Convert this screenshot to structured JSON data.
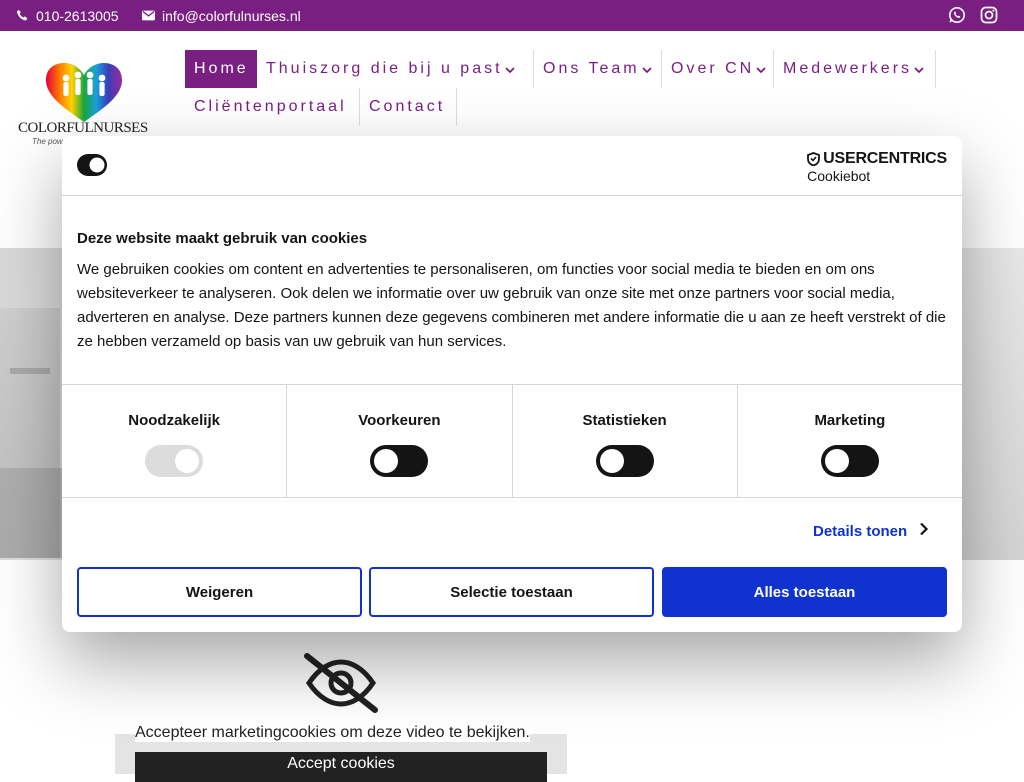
{
  "topbar": {
    "phone": "010-2613005",
    "email": "info@colorfulnurses.nl",
    "phone_icon": "phone-icon",
    "email_icon": "envelope-icon",
    "social_icons": [
      "whatsapp-icon",
      "instagram-icon"
    ],
    "background": "#7a1f82"
  },
  "logo": {
    "text": "COLORFULNURSES",
    "tagline": "The pow"
  },
  "nav": {
    "items": [
      {
        "label": "Home",
        "active": true,
        "dropdown": false
      },
      {
        "label": "Thuiszorg die bij u past",
        "active": false,
        "dropdown": true
      },
      {
        "label": "Ons Team",
        "active": false,
        "dropdown": true
      },
      {
        "label": "Over CN",
        "active": false,
        "dropdown": true
      },
      {
        "label": "Medewerkers",
        "active": false,
        "dropdown": true
      },
      {
        "label": "Cliëntenportaal",
        "active": false,
        "dropdown": false
      },
      {
        "label": "Contact",
        "active": false,
        "dropdown": false
      }
    ],
    "accent": "#7a1f82"
  },
  "video": {
    "message": "Accepteer marketingcookies om deze video te bekijken.",
    "button": "Accept cookies",
    "icon": "eye-slash-icon"
  },
  "cookie_dialog": {
    "brand_line1": "USERCENTRICS",
    "brand_line2": "Cookiebot",
    "title": "Deze website maakt gebruik van cookies",
    "body": "We gebruiken cookies om content en advertenties te personaliseren, om functies voor social media te bieden en om ons websiteverkeer te analyseren. Ook delen we informatie over uw gebruik van onze site met onze partners voor social media, adverteren en analyse. Deze partners kunnen deze gegevens combineren met andere informatie die u aan ze heeft verstrekt of die ze hebben verzameld op basis van uw gebruik van hun services.",
    "categories": [
      {
        "label": "Noodzakelijk",
        "enabled": true,
        "disabled": true
      },
      {
        "label": "Voorkeuren",
        "enabled": false,
        "disabled": false
      },
      {
        "label": "Statistieken",
        "enabled": false,
        "disabled": false
      },
      {
        "label": "Marketing",
        "enabled": false,
        "disabled": false
      }
    ],
    "details_link": "Details tonen",
    "buttons": {
      "deny": "Weigeren",
      "allow_selection": "Selectie toestaan",
      "allow_all": "Alles toestaan"
    },
    "accent": "#1032cf"
  }
}
